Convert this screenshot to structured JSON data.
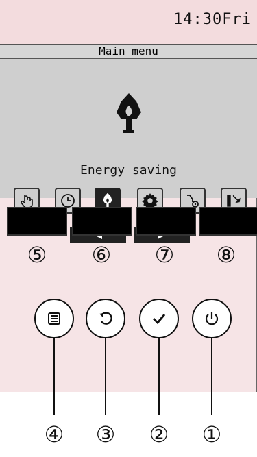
{
  "status_bar": {
    "clock": "14:30Fri"
  },
  "screen": {
    "title": "Main menu",
    "selected_item_label": "Energy saving",
    "menu_icons": [
      "hand-touch-icon",
      "clock-icon",
      "energy-saving-icon",
      "gear-icon",
      "maintenance-icon",
      "service-icon"
    ],
    "nav": {
      "prev_icon": "left-arrow-icon",
      "next_icon": "right-arrow-icon"
    }
  },
  "callouts": {
    "softkeys": [
      "⑤",
      "⑥",
      "⑦",
      "⑧"
    ],
    "buttons": [
      "④",
      "③",
      "②",
      "①"
    ]
  },
  "button_icons": [
    "menu-icon",
    "return-icon",
    "confirm-icon",
    "power-icon"
  ]
}
